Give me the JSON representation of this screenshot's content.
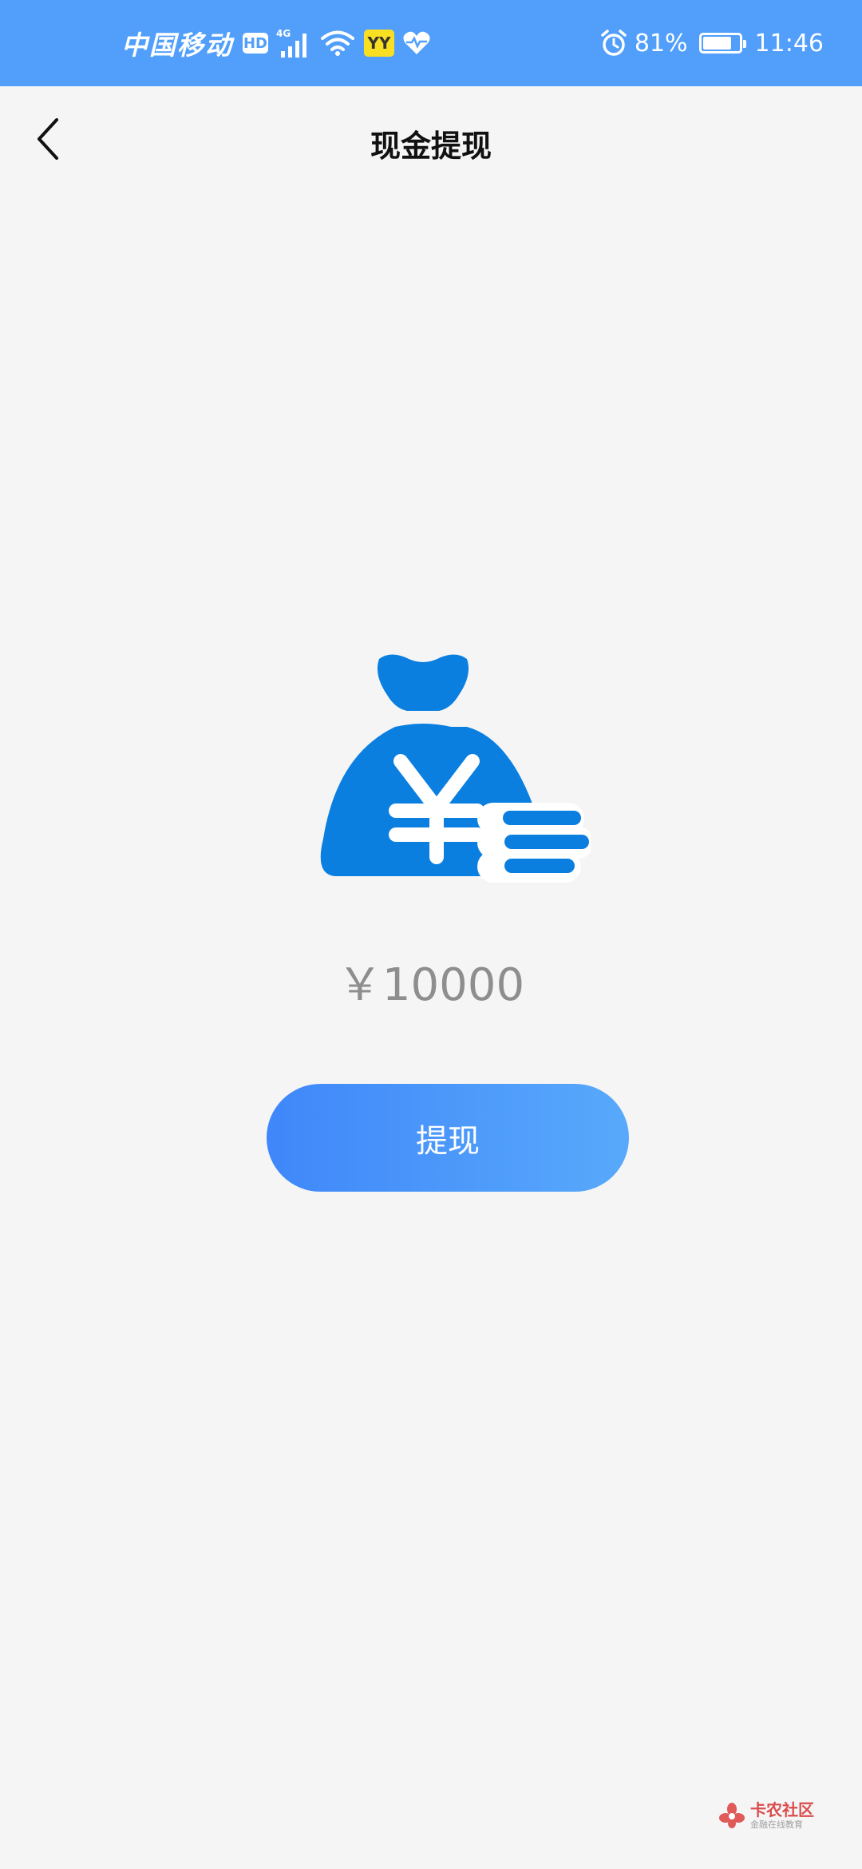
{
  "status_bar": {
    "carrier": "中国移动",
    "hd_label": "HD",
    "network": "4G",
    "app_badge": "YY",
    "battery_percent": "81%",
    "battery_level": 0.81,
    "time": "11:46",
    "color": "#519ffb"
  },
  "header": {
    "title": "现金提现"
  },
  "main": {
    "amount": "￥10000",
    "withdraw_label": "提现",
    "icon_color": "#0a7fe0",
    "button_gradient": [
      "#3f87fa",
      "#58a9fb"
    ]
  },
  "watermark": {
    "name": "卡农社区",
    "tagline": "金融在线教育"
  }
}
